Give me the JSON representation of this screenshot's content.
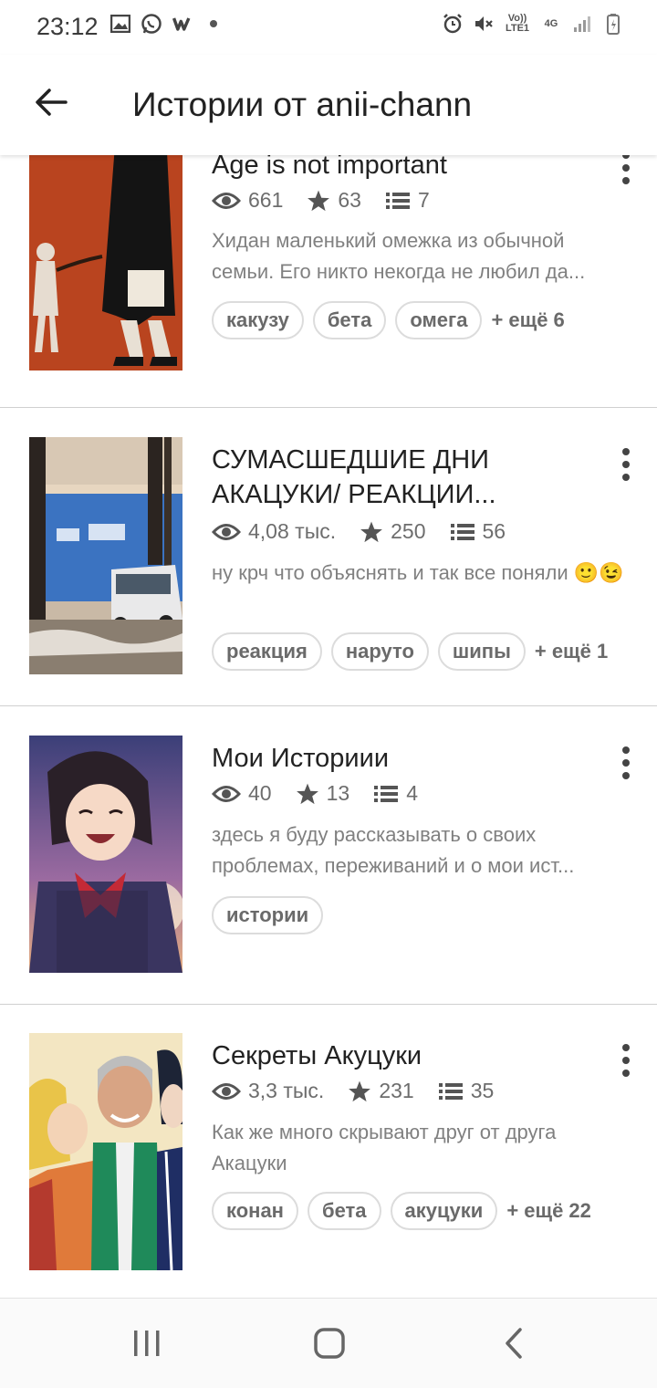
{
  "status_bar": {
    "time": "23:12",
    "left_icons": [
      "image-icon",
      "whatsapp-icon",
      "wattpad-icon",
      "dot-icon"
    ],
    "right_icons": [
      "alarm-icon",
      "mute-icon",
      "volte-icon",
      "4g-icon",
      "signal-icon",
      "battery-icon"
    ],
    "volte_label": "Vo)) LTE1",
    "net_label": "4G"
  },
  "app_bar": {
    "title": "Истории от anii-chann",
    "back_icon": "arrow-left-icon"
  },
  "stories": [
    {
      "title": "Age is not important",
      "views": "661",
      "votes": "63",
      "parts": "7",
      "description": "Хидан маленький омежка из обычной семьи. Его никто некогда не любил да...",
      "tags": [
        "какузу",
        "бета",
        "омега"
      ],
      "more_tags": "+ ещё 6"
    },
    {
      "title": "СУМАСШЕДШИЕ ДНИ АКАЦУКИ/ РЕАКЦИИ...",
      "views": "4,08 тыс.",
      "votes": "250",
      "parts": "56",
      "description": "ну крч что объяснять и так все поняли 🙂😉",
      "tags": [
        "реакция",
        "наруто",
        "шипы"
      ],
      "more_tags": "+ ещё 1"
    },
    {
      "title": "Мои Историии",
      "views": "40",
      "votes": "13",
      "parts": "4",
      "description": "здесь я буду рассказывать о своих проблемах, переживаний  и о мои ист...",
      "tags": [
        "истории"
      ],
      "more_tags": ""
    },
    {
      "title": "Секреты Акуцуки",
      "views": "3,3 тыс.",
      "votes": "231",
      "parts": "35",
      "description": "Как же много скрывают друг от друга Акацуки",
      "tags": [
        "конан",
        "бета",
        "акуцуки"
      ],
      "more_tags": "+ ещё 22"
    }
  ],
  "nav_bar": {
    "icons": [
      "recent-apps-icon",
      "home-icon",
      "back-icon"
    ]
  }
}
